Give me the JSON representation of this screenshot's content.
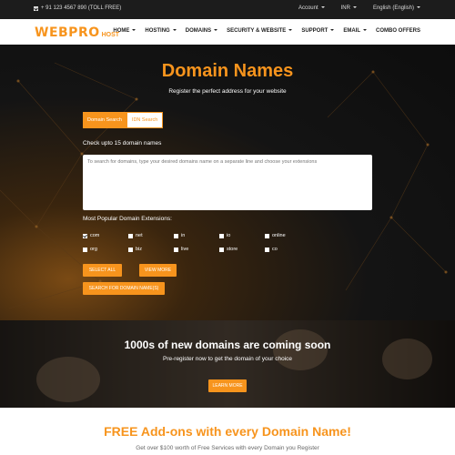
{
  "topbar": {
    "phone": "+ 91 123 4567 890 (TOLL FREE)",
    "account": "Account",
    "currency": "INR",
    "language": "English (English)"
  },
  "header": {
    "logo_main": "WEBPRO",
    "logo_sub": "HOST",
    "nav": [
      {
        "label": "HOME",
        "dropdown": true
      },
      {
        "label": "HOSTING",
        "dropdown": true
      },
      {
        "label": "DOMAINS",
        "dropdown": true
      },
      {
        "label": "SECURITY & WEBSITE",
        "dropdown": true
      },
      {
        "label": "SUPPORT",
        "dropdown": true
      },
      {
        "label": "EMAIL",
        "dropdown": true
      },
      {
        "label": "COMBO OFFERS",
        "dropdown": false
      }
    ]
  },
  "hero": {
    "title": "Domain Names",
    "subtitle": "Register the perfect address for your website",
    "tabs": [
      {
        "label": "Domain Search",
        "active": true
      },
      {
        "label": "IDN Search",
        "active": false
      }
    ],
    "check_label": "Check upto 15 domain names",
    "textarea_placeholder": "To search for domains, type your desired domains name on a separate line and choose your extensions",
    "popular_label": "Most Popular Domain Extensions:",
    "extensions": [
      {
        "label": "com",
        "checked": true
      },
      {
        "label": "net",
        "checked": false
      },
      {
        "label": "in",
        "checked": false
      },
      {
        "label": "io",
        "checked": false
      },
      {
        "label": "online",
        "checked": false
      },
      {
        "label": "org",
        "checked": false
      },
      {
        "label": "biz",
        "checked": false
      },
      {
        "label": "live",
        "checked": false
      },
      {
        "label": "store",
        "checked": false
      },
      {
        "label": "co",
        "checked": false
      }
    ],
    "select_all": "SELECT ALL",
    "view_more": "VIEW MORE",
    "search_button": "SEARCH FOR DOMAIN NAME(S)"
  },
  "coming_soon": {
    "title": "1000s of new domains are coming soon",
    "subtitle": "Pre-register now to get the domain of your choice",
    "button": "LEARN MORE"
  },
  "free_addons": {
    "title": "FREE Add-ons with every Domain Name!",
    "subtitle": "Get over $100 worth of Free Services with every Domain you Register"
  },
  "colors": {
    "accent": "#f7941d",
    "topbar_bg": "#1c1c1c",
    "hero_bg": "#0d0d0d"
  }
}
